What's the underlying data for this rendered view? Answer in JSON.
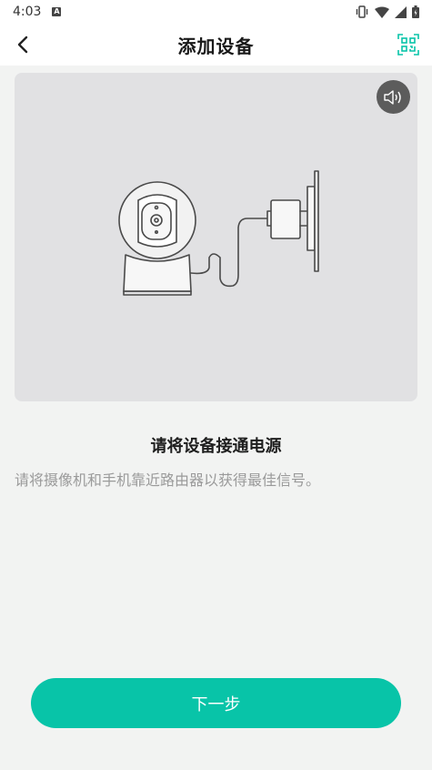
{
  "status_bar": {
    "time": "4:03",
    "notification_badge": "A",
    "icons": [
      "vibrate-icon",
      "wifi-icon",
      "signal-icon",
      "battery-icon"
    ]
  },
  "header": {
    "title": "添加设备",
    "back_icon": "chevron-left-icon",
    "scan_icon": "qr-scan-icon"
  },
  "illustration": {
    "sound_icon": "speaker-icon"
  },
  "instructions": {
    "title": "请将设备接通电源",
    "subtitle": "请将摄像机和手机靠近路由器以获得最佳信号。"
  },
  "footer": {
    "next_label": "下一步"
  },
  "colors": {
    "accent": "#08c4a8",
    "background": "#f2f3f2",
    "illustration_bg": "#e1e1e3"
  }
}
